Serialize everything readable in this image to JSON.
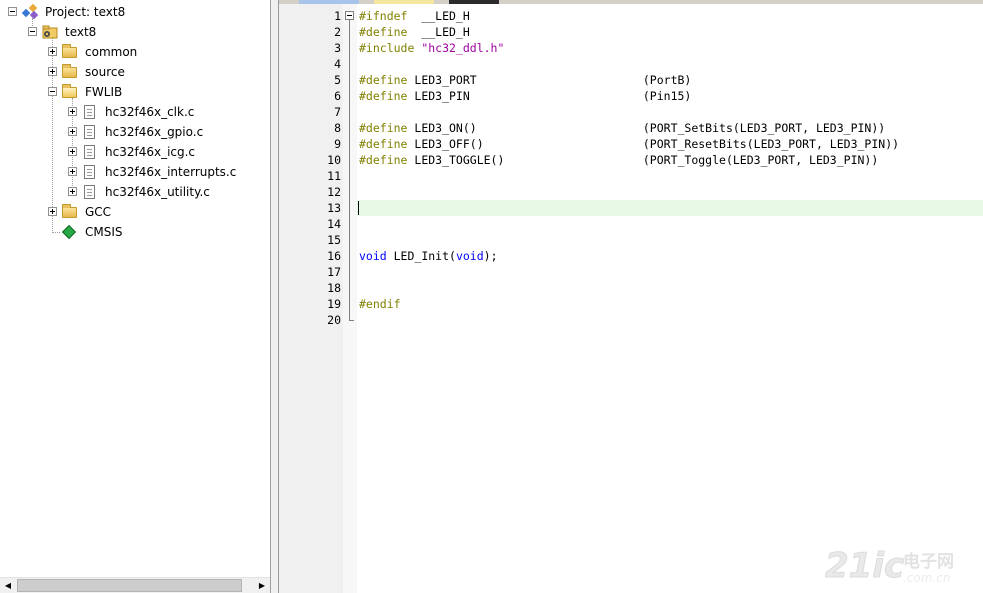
{
  "project_tree": {
    "root_label": "Project: text8",
    "target_label": "text8",
    "groups": [
      {
        "label": "common"
      },
      {
        "label": "source"
      },
      {
        "label": "FWLIB"
      }
    ],
    "fwlib_files": [
      {
        "label": "hc32f46x_clk.c"
      },
      {
        "label": "hc32f46x_gpio.c"
      },
      {
        "label": "hc32f46x_icg.c"
      },
      {
        "label": "hc32f46x_interrupts.c"
      },
      {
        "label": "hc32f46x_utility.c"
      }
    ],
    "after_groups": [
      {
        "label": "GCC"
      },
      {
        "label": "CMSIS"
      }
    ]
  },
  "editor": {
    "line_numbers": [
      "1",
      "2",
      "3",
      "4",
      "5",
      "6",
      "7",
      "8",
      "9",
      "10",
      "11",
      "12",
      "13",
      "14",
      "15",
      "16",
      "17",
      "18",
      "19",
      "20"
    ],
    "current_line": 13,
    "lines": {
      "l1_pp": "#ifndef",
      "l1_rest": "  __LED_H",
      "l2_pp": "#define",
      "l2_rest": "  __LED_H",
      "l3_pp": "#include",
      "l3_str": " \"hc32_ddl.h\"",
      "l5_pp": "#define",
      "l5_rest": " LED3_PORT                        (PortB)",
      "l6_pp": "#define",
      "l6_rest": " LED3_PIN                         (Pin15)",
      "l8_pp": "#define",
      "l8_rest": " LED3_ON()                        (PORT_SetBits(LED3_PORT, LED3_PIN))",
      "l9_pp": "#define",
      "l9_rest": " LED3_OFF()                       (PORT_ResetBits(LED3_PORT, LED3_PIN))",
      "l10_pp": "#define",
      "l10_rest": " LED3_TOGGLE()                    (PORT_Toggle(LED3_PORT, LED3_PIN))",
      "l16_kw1": "void",
      "l16_mid": " LED_Init(",
      "l16_kw2": "void",
      "l16_end": ");",
      "l19_pp": "#endif"
    }
  },
  "watermark": {
    "brand": "21ic",
    "cn": "电子网"
  },
  "colors": {
    "preprocessor": "#808000",
    "keyword": "#0000ff",
    "string": "#a000a0",
    "current_line_bg": "#e6fae6"
  }
}
